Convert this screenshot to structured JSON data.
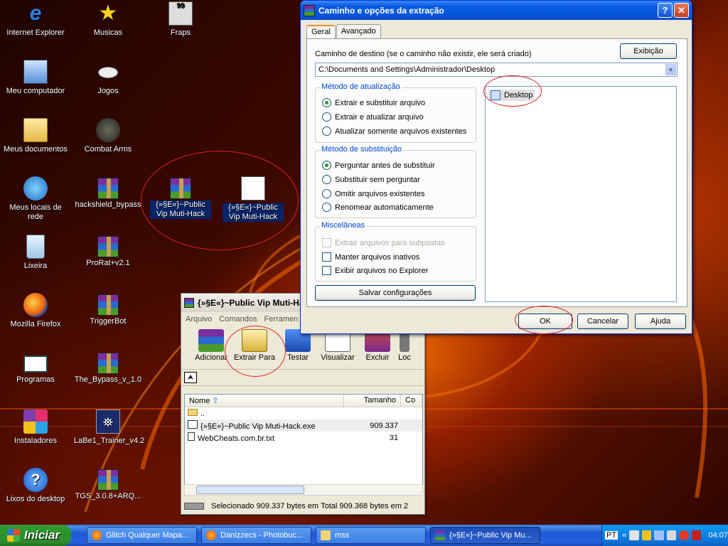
{
  "desktop": {
    "icons": [
      {
        "label": "Internet Explorer"
      },
      {
        "label": "Musicas"
      },
      {
        "label": "Fraps"
      },
      {
        "label": "Meu computador"
      },
      {
        "label": "Jogos"
      },
      {
        "label": "Meus documentos"
      },
      {
        "label": "Combat Arms"
      },
      {
        "label": "Meus locais de rede"
      },
      {
        "label": "hackshield_bypass"
      },
      {
        "label": "{»§E«}~Public Vip Muti-Hack"
      },
      {
        "label": "{»§E«}~Public Vip Muti-Hack"
      },
      {
        "label": "Lixeira"
      },
      {
        "label": "ProRat+v2.1"
      },
      {
        "label": "Mozilla Firefox"
      },
      {
        "label": "TriggerBot"
      },
      {
        "label": "Programas"
      },
      {
        "label": "The_Bypass_v_1.0"
      },
      {
        "label": "Instaladores"
      },
      {
        "label": "LaBe1_Trainer_v4.2"
      },
      {
        "label": "Lixos do desktop"
      },
      {
        "label": "TGS_3.0.8+ARQ..."
      }
    ]
  },
  "dialog": {
    "title": "Caminho e opções da extração",
    "tabs": [
      "Geral",
      "Avançado"
    ],
    "dest_label": "Caminho de destino (se o caminho não existir, ele será criado)",
    "view_button": "Exibição",
    "dest_path": "C:\\Documents and Settings\\Administrador\\Desktop",
    "update_group": {
      "title": "Método de atualização",
      "options": [
        "Extrair e substituir arquivo",
        "Extrair e atualizar arquivo",
        "Atualizar somente arquivos existentes"
      ],
      "selected": 0
    },
    "overwrite_group": {
      "title": "Método de substituição",
      "options": [
        "Perguntar antes de substituir",
        "Substituir sem perguntar",
        "Omitir arquivos existentes",
        "Renomear automaticamente"
      ],
      "selected": 0
    },
    "misc_group": {
      "title": "Miscelâneas",
      "options": [
        "Extrair arquivos para subpastas",
        "Manter arquivos inativos",
        "Exibir arquivos no Explorer"
      ]
    },
    "save_button": "Salvar configurações",
    "tree_item": "Desktop",
    "ok": "OK",
    "cancel": "Cancelar",
    "help": "Ajuda"
  },
  "winrar": {
    "title": "{»§E«}~Public Vip Muti-Hack",
    "menu": [
      "Arquivo",
      "Comandos",
      "Ferramen"
    ],
    "tools": [
      "Adicionar",
      "Extrair Para",
      "Testar",
      "Visualizar",
      "Excluir",
      "Loc"
    ],
    "columns": [
      "Nome",
      "Tamanho",
      "Co"
    ],
    "files": [
      {
        "name": "..",
        "size": ""
      },
      {
        "name": "{»§E«}~Public Vip Muti-Hack.exe",
        "size": "909.337"
      },
      {
        "name": "WebCheats.com.br.txt",
        "size": "31"
      }
    ],
    "status": "Selecionado 909.337 bytes em",
    "status2": "Total 909.368 bytes em 2"
  },
  "taskbar": {
    "start": "Iniciar",
    "tasks": [
      "Glitch Qualquer Mapa...",
      "Danizzecs - Photobuc...",
      "mss",
      "{»§E«}~Public Vip Mu..."
    ],
    "lang": "PT",
    "clock": "04:07"
  }
}
